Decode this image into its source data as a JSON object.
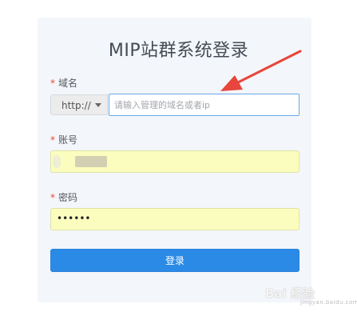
{
  "login": {
    "title": "MIP站群系统登录",
    "domain_label": "域名",
    "account_label": "账号",
    "password_label": "密码",
    "required_mark": "*",
    "protocol_value": "http://",
    "domain_placeholder": "请输入管理的域名或者ip",
    "password_mask": "••••••",
    "login_button": "登录"
  },
  "watermark": {
    "text": "Bai 经验",
    "sub": "jingyan.baidu.com"
  },
  "colors": {
    "accent": "#2b8ae6",
    "arrow": "#e8453c",
    "autofill": "#fbfdbe",
    "required": "#e64b3b"
  }
}
